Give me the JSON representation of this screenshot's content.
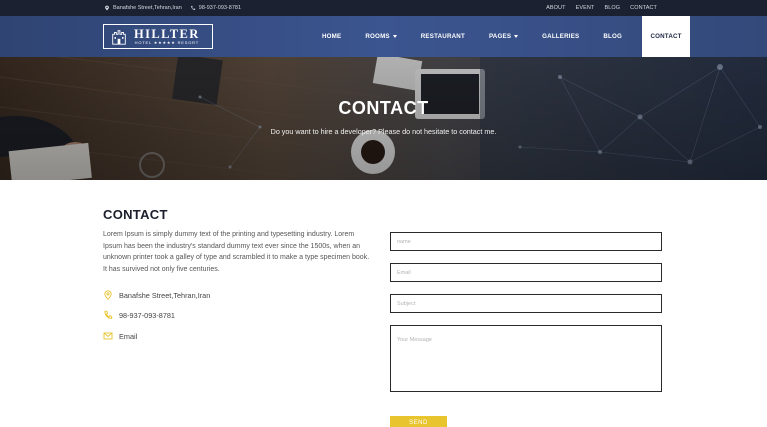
{
  "topbar": {
    "address": "Banafshe Street,Tehran,Iran",
    "phone": "98-937-093-8781",
    "links": [
      "ABOUT",
      "EVENT",
      "BLOG",
      "CONTACT"
    ]
  },
  "brand": {
    "name": "HILLTER",
    "tagline": "HOTEL ★★★★★ RESORT"
  },
  "nav": {
    "items": [
      "HOME",
      "ROOMS",
      "RESTAURANT",
      "PAGES",
      "GALLERIES",
      "BLOG",
      "CONTACT"
    ],
    "active": "CONTACT"
  },
  "hero": {
    "title": "CONTACT",
    "subtitle": "Do you want to hire a developer? Please do not hesitate to contact me."
  },
  "contact": {
    "title": "CONTACT",
    "body": "Lorem Ipsum is simply dummy text of the printing and typesetting industry. Lorem Ipsum has been the industry's standard dummy text ever since the 1500s, when an unknown printer took a galley of type and scrambled it to make a type specimen book. It has survived not only five centuries.",
    "address": "Banafshe Street,Tehran,Iran",
    "phone": "98-937-093-8781",
    "email": "Email"
  },
  "form": {
    "name_placeholder": "name",
    "email_placeholder": "Email",
    "subject_placeholder": "Subject",
    "message_placeholder": "Your Message",
    "send_label": "SEND"
  },
  "colors": {
    "topbar": "#1b2131",
    "nav": "#3b5590",
    "accent": "#e8c42f"
  }
}
